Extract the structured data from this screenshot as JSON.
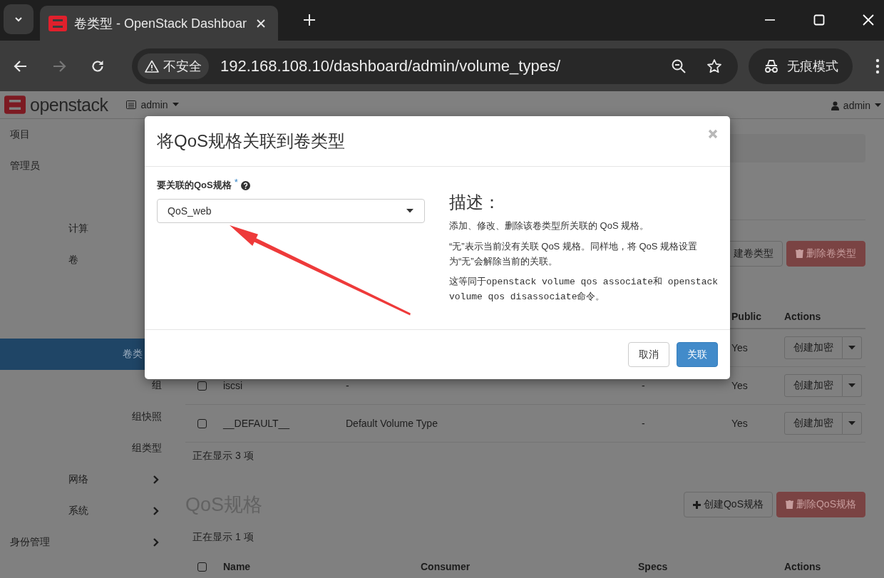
{
  "browser": {
    "tabs": [
      {
        "title": "卷类型 - OpenStack Dashboar",
        "selected": true
      }
    ],
    "security_label": "不安全",
    "url": "192.168.108.10/dashboard/admin/volume_types/",
    "incognito_label": "无痕模式"
  },
  "topbar": {
    "brand": "openstack",
    "project_menu": "admin",
    "user_menu": "admin"
  },
  "sidebar": {
    "items": [
      {
        "label": "项目"
      },
      {
        "label": "管理员",
        "children": [
          {
            "label": "计算"
          },
          {
            "label": "卷",
            "children": [
              {
                "label": "卷类",
                "selected": true
              },
              {
                "label": "组",
                "selected": false
              },
              {
                "label": "组快照",
                "selected": false
              },
              {
                "label": "组类型",
                "selected": false
              }
            ]
          },
          {
            "label": "网络",
            "expanded": false
          },
          {
            "label": "系统",
            "expanded": false
          }
        ]
      },
      {
        "label": "身份管理",
        "expanded": false
      }
    ]
  },
  "volume_types": {
    "buttons": [
      {
        "label": "建卷类型",
        "kind": "default"
      },
      {
        "label": "删除卷类型",
        "kind": "danger"
      }
    ],
    "header": {
      "public": "Public",
      "actions": "Actions"
    },
    "rows": [
      {
        "public": "Yes",
        "action": "创建加密"
      },
      {
        "checked": false,
        "name": "iscsi",
        "description": "-",
        "qos": "-",
        "public": "Yes",
        "action": "创建加密"
      },
      {
        "checked": false,
        "name": "__DEFAULT__",
        "description": "Default Volume Type",
        "qos": "-",
        "public": "Yes",
        "action": "创建加密"
      }
    ],
    "count": "正在显示 3 项"
  },
  "qos_specs": {
    "title": "QoS规格",
    "buttons": [
      {
        "label": "创建QoS规格",
        "kind": "create"
      },
      {
        "label": "删除QoS规格",
        "kind": "danger"
      }
    ],
    "count": "正在显示 1 项",
    "header_checked": false,
    "header": {
      "name": "Name",
      "consumer": "Consumer",
      "specs": "Specs",
      "actions": "Actions"
    }
  },
  "modal": {
    "title": "将QoS规格关联到卷类型",
    "field_label": "要关联的QoS规格",
    "required_mark": "*",
    "select_value": "QoS_web",
    "description_title": "描述：",
    "paragraphs": [
      {
        "kind": "text",
        "text": "添加、修改、删除该卷类型所关联的 QoS 规格。"
      },
      {
        "kind": "text",
        "text": "“无”表示当前没有关联 QoS 规格。同样地，将 QoS 规格设置为“无”会解除当前的关联。"
      },
      {
        "kind": "mono",
        "text": "这等同于openstack volume qos associate和 openstack volume qos disassociate命令。"
      }
    ],
    "buttons": [
      {
        "label": "取消",
        "kind": "default"
      },
      {
        "label": "关联",
        "kind": "primary"
      }
    ]
  }
}
